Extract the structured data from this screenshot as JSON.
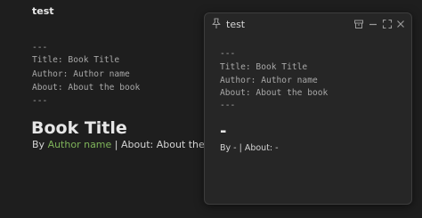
{
  "main": {
    "title": "test",
    "frontmatter_open": "---",
    "title_line": "Title: Book Title",
    "author_line": "Author: Author name",
    "about_line": "About: About the book",
    "frontmatter_close": "---",
    "book_title": "Book Title",
    "by_prefix": "By",
    "author_link": "Author name",
    "about_segment": "| About: About the book"
  },
  "popout": {
    "title": "test",
    "frontmatter_open": "---",
    "title_line": "Title: Book Title",
    "author_line": "Author: Author name",
    "about_line": "About: About the book",
    "frontmatter_close": "---",
    "book_title": "-",
    "byline": "By - | About: -",
    "icons": [
      "pin-icon",
      "archive-icon",
      "minimize-icon",
      "maximize-icon",
      "close-icon"
    ]
  },
  "colors": {
    "background": "#1e1e1e",
    "popout_bg": "#262626",
    "accent": "#7fb45a"
  }
}
